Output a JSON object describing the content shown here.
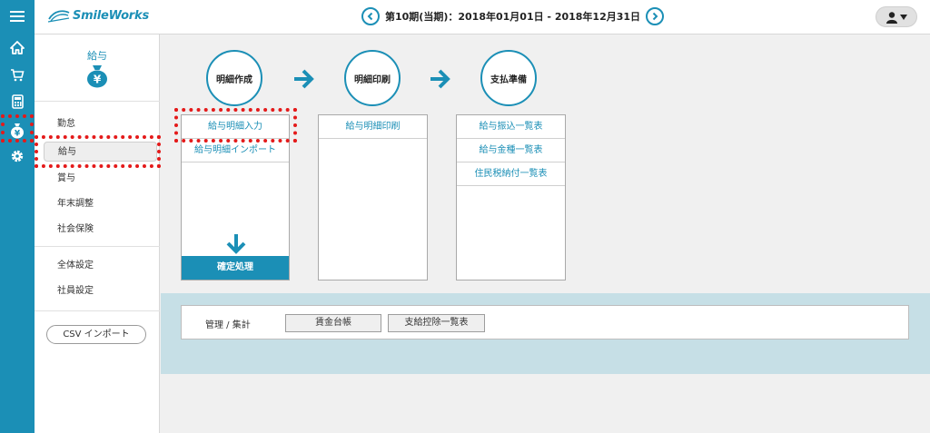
{
  "header": {
    "brand": "SmileWorks",
    "period": "第10期(当期)：2018年01月01日 - 2018年12月31日"
  },
  "rail": {
    "icons": [
      "menu-icon",
      "home-icon",
      "cart-icon",
      "calculator-icon",
      "yen-bag-icon",
      "gear-icon"
    ]
  },
  "sidebar": {
    "title": "給与",
    "items": [
      {
        "label": "勤怠"
      },
      {
        "label": "給与"
      },
      {
        "label": "賞与"
      },
      {
        "label": "年末調整"
      },
      {
        "label": "社会保険"
      },
      {
        "label": "全体設定"
      },
      {
        "label": "社員設定"
      }
    ],
    "csv_button": "CSV インポート"
  },
  "flow": {
    "steps": [
      {
        "label": "明細作成"
      },
      {
        "label": "明細印刷"
      },
      {
        "label": "支払準備"
      }
    ],
    "panel1": {
      "items": [
        "給与明細入力",
        "給与明細インポート"
      ],
      "confirm": "確定処理"
    },
    "panel2": {
      "items": [
        "給与明細印刷"
      ]
    },
    "panel3": {
      "items": [
        "給与振込一覧表",
        "給与金種一覧表",
        "住民税納付一覧表"
      ]
    }
  },
  "management": {
    "label": "管理 / 集計",
    "buttons": [
      "賃金台帳",
      "支給控除一覧表"
    ]
  },
  "colors": {
    "accent": "#1b8fb6",
    "highlight": "#e41a1a"
  }
}
